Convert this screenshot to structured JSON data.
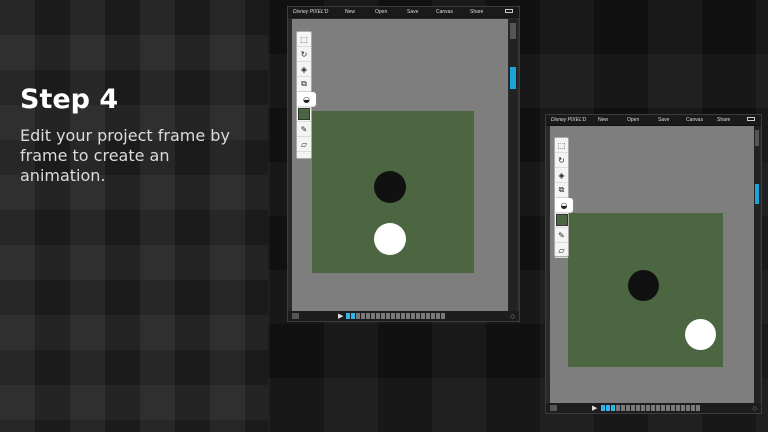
{
  "step": {
    "title": "Step 4",
    "description": "Edit your project frame by frame to create an animation."
  },
  "app": {
    "logo": "Disney PIXEL'D",
    "menu": [
      "New",
      "Open",
      "Save",
      "Canvas",
      "Share"
    ],
    "tools": [
      "select-icon",
      "rotate-icon",
      "layer-icon",
      "copy-icon",
      "fill-icon",
      "color-swatch",
      "pencil-icon",
      "eraser-icon"
    ],
    "swatch_color": "#4b6641"
  },
  "screens": [
    {
      "current_frame": 2,
      "frame_count": 20
    },
    {
      "current_frame": 3,
      "frame_count": 20
    }
  ],
  "colors": {
    "canvas_gray": "#7e7e7e",
    "art_green": "#4b6641",
    "accent_blue": "#1aa4d8"
  }
}
